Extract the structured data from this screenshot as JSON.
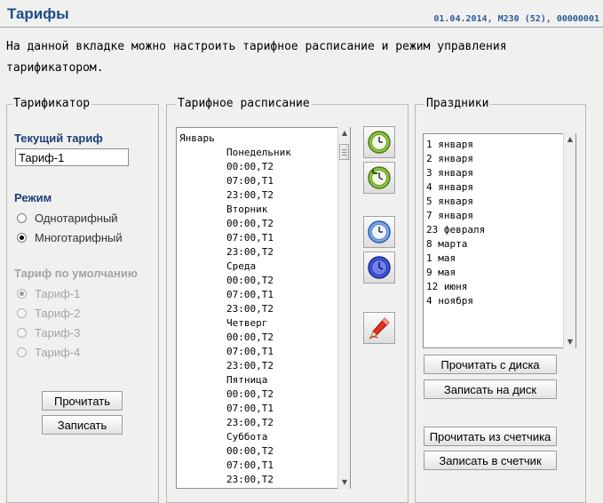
{
  "header": {
    "title": "Тарифы",
    "meta": "01.04.2014, M230 (52), 00000001"
  },
  "description": "На данной вкладке можно настроить тарифное расписание и режим управления тарификатором.",
  "tariffer": {
    "legend": "Тарификатор",
    "current_label": "Текущий тариф",
    "current_value": "Тариф-1",
    "mode_label": "Режим",
    "modes": [
      {
        "label": "Однотарифный",
        "checked": false
      },
      {
        "label": "Многотарифный",
        "checked": true
      }
    ],
    "default_label": "Тариф по умолчанию",
    "defaults": [
      {
        "label": "Тариф-1",
        "checked": true
      },
      {
        "label": "Тариф-2",
        "checked": false
      },
      {
        "label": "Тариф-3",
        "checked": false
      },
      {
        "label": "Тариф-4",
        "checked": false
      }
    ],
    "read_button": "Прочитать",
    "write_button": "Записать"
  },
  "schedule": {
    "legend": "Тарифное расписание",
    "lines": [
      "Январь",
      "        Понедельник",
      "        00:00,T2",
      "        07:00,T1",
      "        23:00,T2",
      "        Вторник",
      "        00:00,T2",
      "        07:00,T1",
      "        23:00,T2",
      "        Среда",
      "        00:00,T2",
      "        07:00,T1",
      "        23:00,T2",
      "        Четверг",
      "        00:00,T2",
      "        07:00,T1",
      "        23:00,T2",
      "        Пятница",
      "        00:00,T2",
      "        07:00,T1",
      "        23:00,T2",
      "        Суббота",
      "        00:00,T2",
      "        07:00,T1",
      "        23:00,T2"
    ],
    "tools": [
      "clock-read-icon",
      "clock-undo-icon",
      "clock-blue-icon",
      "clock-blue-dark-icon",
      "pen-icon"
    ]
  },
  "holidays": {
    "legend": "Праздники",
    "items": [
      "1 января",
      "2 января",
      "3 января",
      "4 января",
      "5 января",
      "7 января",
      "23 февраля",
      "8 марта",
      "1 мая",
      "9 мая",
      "12 июня",
      "4 ноября"
    ],
    "read_disk": "Прочитать с диска",
    "write_disk": "Записать на диск",
    "read_meter": "Прочитать из счетчика",
    "write_meter": "Записать в счетчик"
  }
}
